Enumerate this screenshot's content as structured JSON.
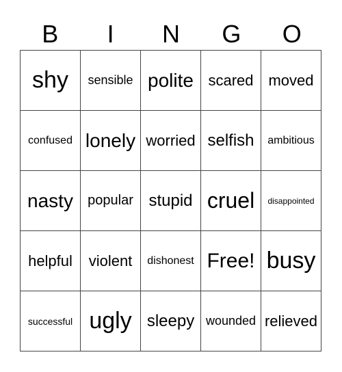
{
  "header": [
    "B",
    "I",
    "N",
    "G",
    "O"
  ],
  "rows": [
    [
      "shy",
      "sensible",
      "polite",
      "scared",
      "moved"
    ],
    [
      "confused",
      "lonely",
      "worried",
      "selfish",
      "ambitious"
    ],
    [
      "nasty",
      "popular",
      "stupid",
      "cruel",
      "disappointed"
    ],
    [
      "helpful",
      "violent",
      "dishonest",
      "Free!",
      "busy"
    ],
    [
      "successful",
      "ugly",
      "sleepy",
      "wounded",
      "relieved"
    ]
  ]
}
